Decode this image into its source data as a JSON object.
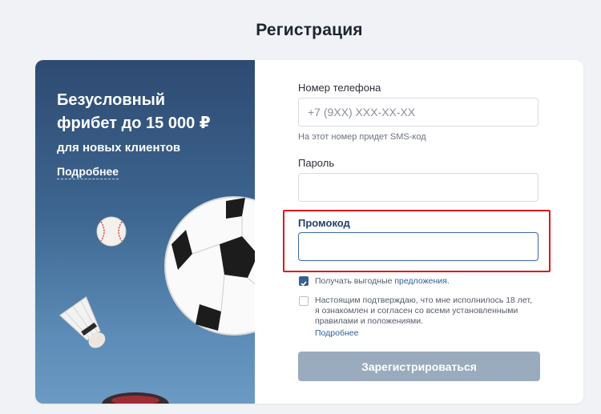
{
  "page": {
    "title": "Регистрация"
  },
  "promo": {
    "headline_line1": "Безусловный",
    "headline_line2": "фрибет до 15 000 ₽",
    "subtitle": "для новых клиентов",
    "more_link": "Подробнее"
  },
  "form": {
    "phone": {
      "label": "Номер телефона",
      "placeholder": "+7 (9XX) XXX-XX-XX",
      "hint": "На этот номер придет SMS-код",
      "value": ""
    },
    "password": {
      "label": "Пароль",
      "value": ""
    },
    "promocode": {
      "label": "Промокод",
      "value": ""
    },
    "offers_checkbox": {
      "checked": true,
      "text": "Получать выгодные ",
      "link": "предложения",
      "suffix": "."
    },
    "terms_checkbox": {
      "checked": false,
      "line1": "Настоящим подтверждаю, что мне исполнилось 18 лет,",
      "line2": "я ознакомлен и согласен со всеми установленными",
      "line3": "правилами и положениями.",
      "link": "Подробнее"
    },
    "submit_label": "Зарегистрироваться"
  },
  "colors": {
    "accent": "#3a5f93",
    "highlight_frame": "#e0161b",
    "submit_disabled": "#9aabbe",
    "panel_top": "#2e4a72",
    "panel_bottom": "#6b9ac3"
  }
}
